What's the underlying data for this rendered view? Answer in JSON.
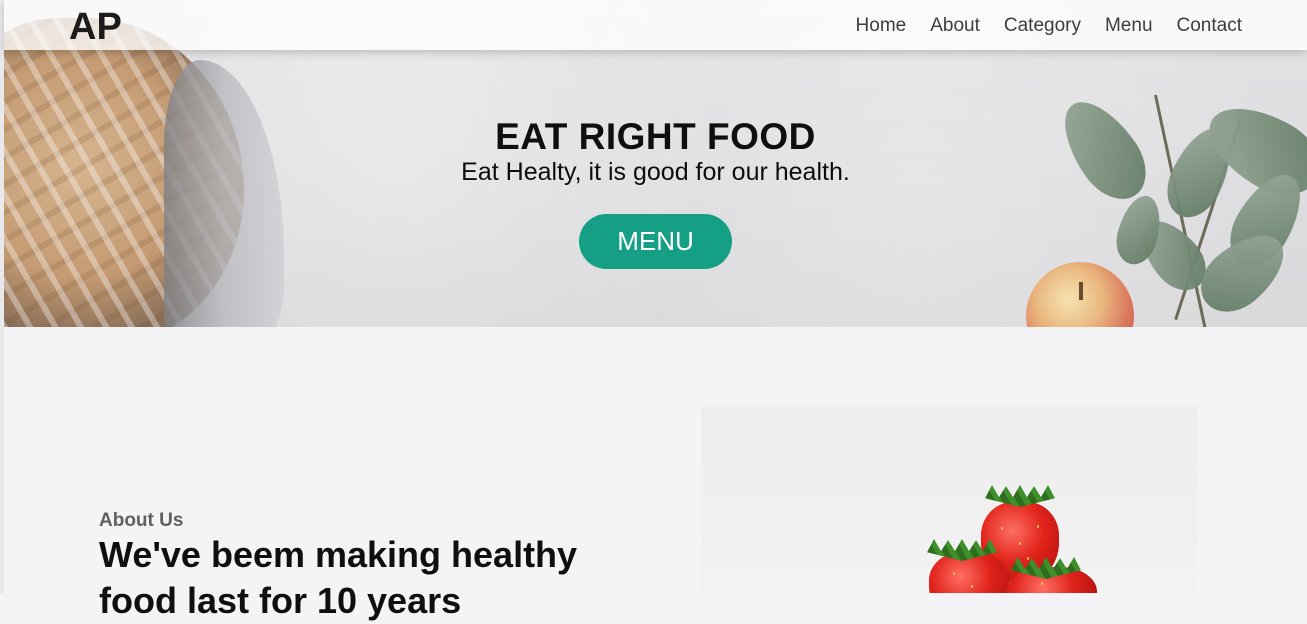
{
  "nav": {
    "logo": "AP",
    "links": [
      "Home",
      "About",
      "Category",
      "Menu",
      "Contact"
    ]
  },
  "hero": {
    "title": "EAT RIGHT FOOD",
    "subtitle": "Eat Healty, it is good for our health.",
    "button_label": "MENU"
  },
  "about": {
    "eyebrow": "About Us",
    "heading": "We've beem making healthy food last for 10 years"
  },
  "colors": {
    "accent": "#159f84",
    "text": "#0f0f10",
    "page_background": "#f4f4f6"
  }
}
